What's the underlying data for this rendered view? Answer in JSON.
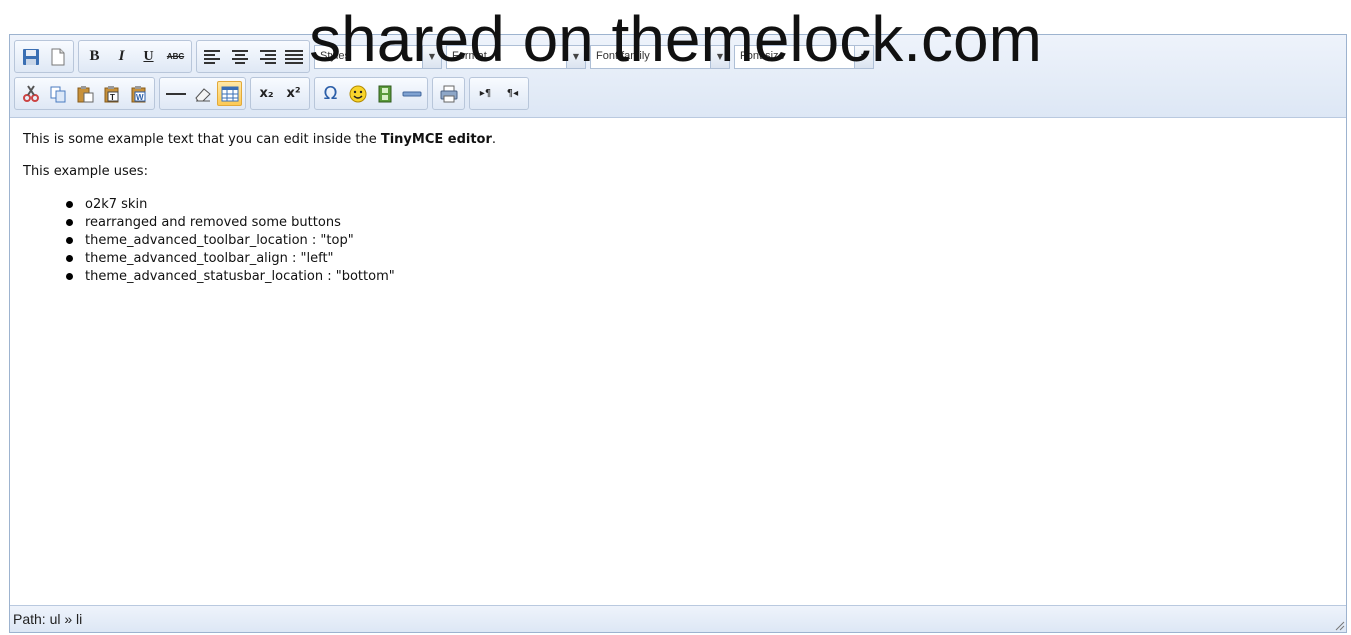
{
  "watermark": "shared on themelock.com",
  "toolbar": {
    "row1": {
      "bold": "B",
      "italic": "I",
      "underline": "U",
      "strikethrough": "ABC",
      "styles_label": "Styles",
      "format_label": "Format",
      "font_family_label": "Font family",
      "font_size_label": "Font size"
    },
    "row2": {
      "subscript": "x₂",
      "superscript": "x²",
      "omega": "Ω",
      "ltr": "▸¶",
      "rtl": "¶◂"
    }
  },
  "content": {
    "para1_prefix": "This is some example text that you can edit inside the ",
    "para1_bold": "TinyMCE editor",
    "para1_suffix": ".",
    "para2": "This example uses:",
    "list": [
      "o2k7 skin",
      "rearranged and removed some buttons",
      "theme_advanced_toolbar_location : \"top\"",
      "theme_advanced_toolbar_align : \"left\"",
      "theme_advanced_statusbar_location : \"bottom\""
    ]
  },
  "statusbar": {
    "path_label": "Path: ",
    "path_value": "ul » li"
  },
  "colors": {
    "accent_border": "#9db3cf",
    "toolbar_bg": "#dde7f5",
    "active_button": "#fcc954"
  }
}
